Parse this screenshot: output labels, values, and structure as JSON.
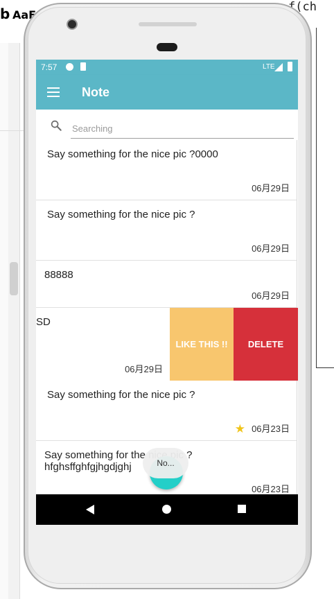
{
  "ide": {
    "title_left": "b",
    "title_right": "AaE",
    "code_fragment": "f(ch"
  },
  "statusbar": {
    "time": "7:57",
    "network": "LTE"
  },
  "toolbar": {
    "title": "Note"
  },
  "search": {
    "placeholder": "Searching"
  },
  "notes": [
    {
      "text": "Say something for the nice pic ?0000",
      "date": "06月29日",
      "starred": false
    },
    {
      "text": "Say something for the nice pic ?",
      "date": "06月29日",
      "starred": false
    },
    {
      "text": "88888",
      "date": "06月29日",
      "starred": false
    },
    {
      "text": "SD",
      "date": "06月29日",
      "starred": false
    },
    {
      "text": "Say something for the nice pic ?",
      "date": "06月23日",
      "starred": true
    },
    {
      "text": "Say something for the nice pic ?\nhfghsffghfgjhgdjghj",
      "date": "06月23日",
      "starred": false
    }
  ],
  "swipe_actions": {
    "like_label": "LIKE THIS !!",
    "delete_label": "DELETE",
    "like_color": "#f8c66e",
    "delete_color": "#d6303a"
  },
  "toast": {
    "text": "No..."
  },
  "colors": {
    "primary": "#5bb7c7",
    "fab": "#23cfc8"
  }
}
